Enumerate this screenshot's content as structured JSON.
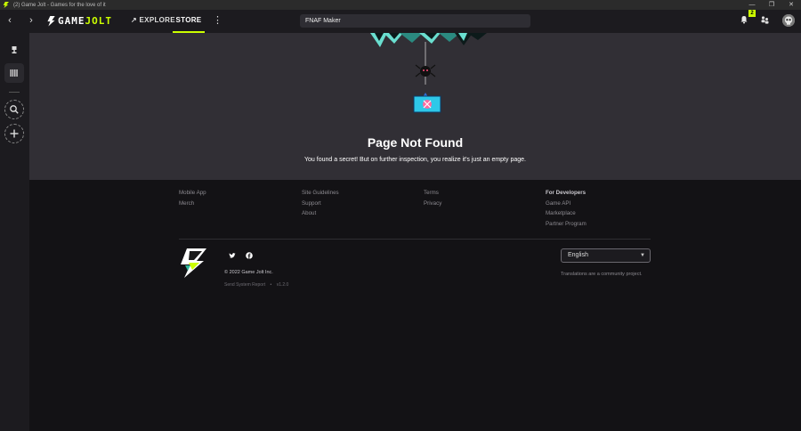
{
  "window": {
    "title": "(2) Game Jolt - Games for the love of it",
    "controls": [
      "—",
      "❐",
      "✕"
    ]
  },
  "topbar": {
    "back_glyph": "‹",
    "forward_glyph": "›",
    "logo_word1": "GAME",
    "logo_word2": "JOLT",
    "explore_label": "EXPLORE",
    "explore_glyph": "↗",
    "store_label": "STORE",
    "more_glyph": "⋮",
    "search_value": "FNAF Maker",
    "notification_count": "2"
  },
  "hero": {
    "title": "Page Not Found",
    "message": "You found a secret! But on further inspection, you realize it's just an empty page."
  },
  "footer": {
    "col1": [
      "Mobile App",
      "Merch"
    ],
    "col2": [
      "Site Guidelines",
      "Support",
      "About"
    ],
    "col3": [
      "Terms",
      "Privacy"
    ],
    "col4_header": "For Developers",
    "col4": [
      "Game API",
      "Marketplace",
      "Partner Program"
    ],
    "copyright": "© 2022 Game Jolt Inc.",
    "system_report": "Send System Report",
    "bullet": "•",
    "version": "v1.2.0",
    "language": "English",
    "language_note": "Translations are a community project."
  },
  "colors": {
    "accent": "#ccff00",
    "hero_bg": "#312f35",
    "page_bg": "#131215",
    "bar_bg": "#1c1b1f"
  }
}
